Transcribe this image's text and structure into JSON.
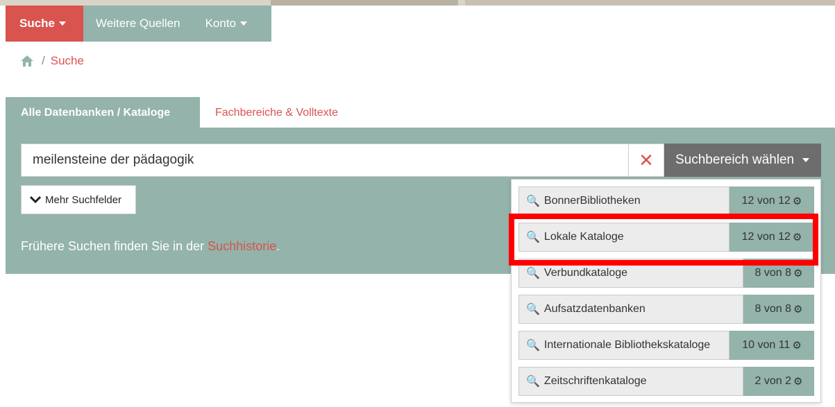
{
  "nav": {
    "search_label": "Suche",
    "more_sources_label": "Weitere Quellen",
    "account_label": "Konto"
  },
  "breadcrumb": {
    "current": "Suche"
  },
  "tabs": {
    "all_label": "Alle Datenbanken / Kataloge",
    "fields_label": "Fachbereiche & Volltexte"
  },
  "search": {
    "value": "meilensteine der pädagogik",
    "clear_symbol": "✕",
    "scope_label": "Suchbereich wählen",
    "more_fields_label": "Mehr Suchfelder"
  },
  "history": {
    "prefix": "Frühere Suchen finden Sie in der ",
    "link": "Suchhistorie",
    "suffix": "."
  },
  "scopes": [
    {
      "label": "BonnerBibliotheken",
      "count": "12 von 12"
    },
    {
      "label": "Lokale Kataloge",
      "count": "12 von 12"
    },
    {
      "label": "Verbundkataloge",
      "count": "8 von 8"
    },
    {
      "label": "Aufsatzdatenbanken",
      "count": "8 von 8"
    },
    {
      "label": "Internationale Bibliothekskataloge",
      "count": "10 von 11"
    },
    {
      "label": "Zeitschriftenkataloge",
      "count": "2 von 2"
    }
  ],
  "colors": {
    "accent_red": "#d9534f",
    "panel_teal": "#93b3ab",
    "highlight": "#ff0000"
  }
}
